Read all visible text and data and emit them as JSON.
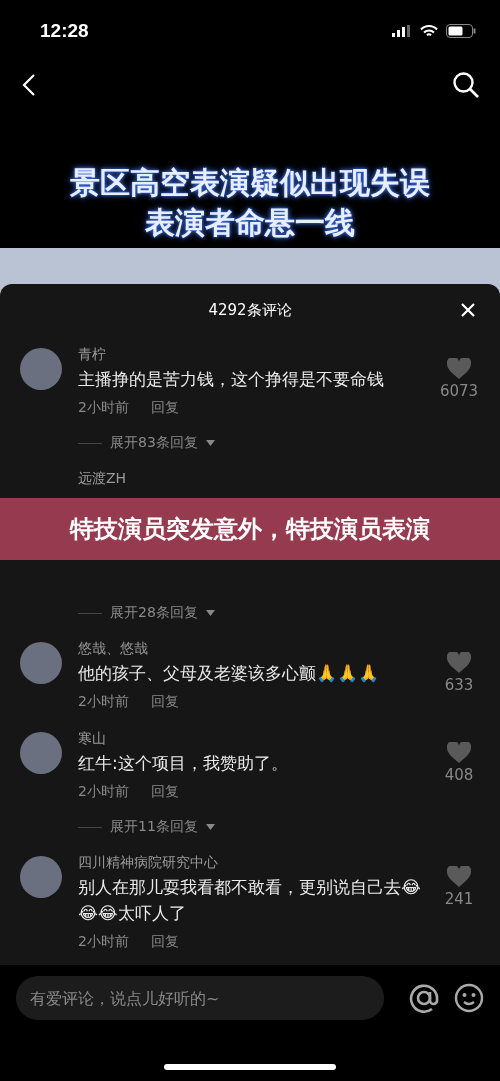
{
  "status_bar": {
    "time": "12:28"
  },
  "video": {
    "caption_lines": [
      "景区高空表演疑似出现失误",
      "表演者命悬一线"
    ]
  },
  "comments_sheet": {
    "title": "4292条评论",
    "comments": [
      {
        "name": "青柠",
        "text": "主播挣的是苦力钱，这个挣得是不要命钱",
        "time": "2小时前",
        "reply": "回复",
        "likes": "6073",
        "expand": "展开83条回复"
      },
      {
        "name": "远渡ZH",
        "expand": "展开28条回复"
      },
      {
        "name": "悠哉、悠哉",
        "text": "他的孩子、父母及老婆该多心颤🙏🙏🙏",
        "time": "2小时前",
        "reply": "回复",
        "likes": "633"
      },
      {
        "name": "寒山",
        "text": "红牛:这个项目，我赞助了。",
        "time": "2小时前",
        "reply": "回复",
        "likes": "408",
        "expand": "展开11条回复"
      },
      {
        "name": "四川精神病院研究中心",
        "text": "别人在那儿耍我看都不敢看，更别说自己去😂😂😂太吓人了",
        "time": "2小时前",
        "reply": "回复",
        "likes": "241"
      }
    ]
  },
  "overlay_banner": {
    "text": "特技演员突发意外，特技演员表演"
  },
  "comment_input": {
    "placeholder": "有爱评论，说点儿好听的~"
  }
}
